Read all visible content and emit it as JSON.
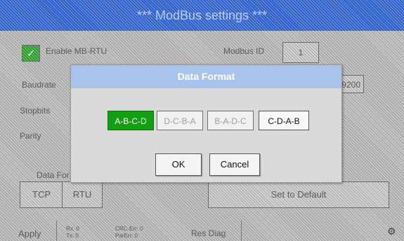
{
  "header": {
    "title": "***  ModBus settings  ***"
  },
  "background": {
    "enable_label": "Enable MB-RTU",
    "enable_check": "✓",
    "modbus_id_label": "Modbus ID",
    "modbus_id_value": "1",
    "baudrate_label": "Baudrate",
    "baudrate_value": "9200",
    "stopbits_label": "Stopbits",
    "parity_label": "Parity",
    "data_format_label": "Data For",
    "tcp_label": "TCP",
    "rtu_label": "RTU",
    "set_default_label": "Set to Default"
  },
  "footer": {
    "apply_label": "Apply",
    "rx_label": "Rx: 0",
    "tx_label": "Tx: 0",
    "crc_label": "CRC-Err: 0",
    "parerr_label": "ParErr:  0",
    "res_diag_label": "Res Diag"
  },
  "dialog": {
    "title": "Data Format",
    "options": [
      "A-B-C-D",
      "D-C-B-A",
      "B-A-D-C",
      "C-D-A-B"
    ],
    "selected": "A-B-C-D",
    "ok_label": "OK",
    "cancel_label": "Cancel"
  },
  "colors": {
    "accent": "#10a010",
    "header": "#2c5ec8",
    "dialog_title": "#a8c4ec"
  }
}
